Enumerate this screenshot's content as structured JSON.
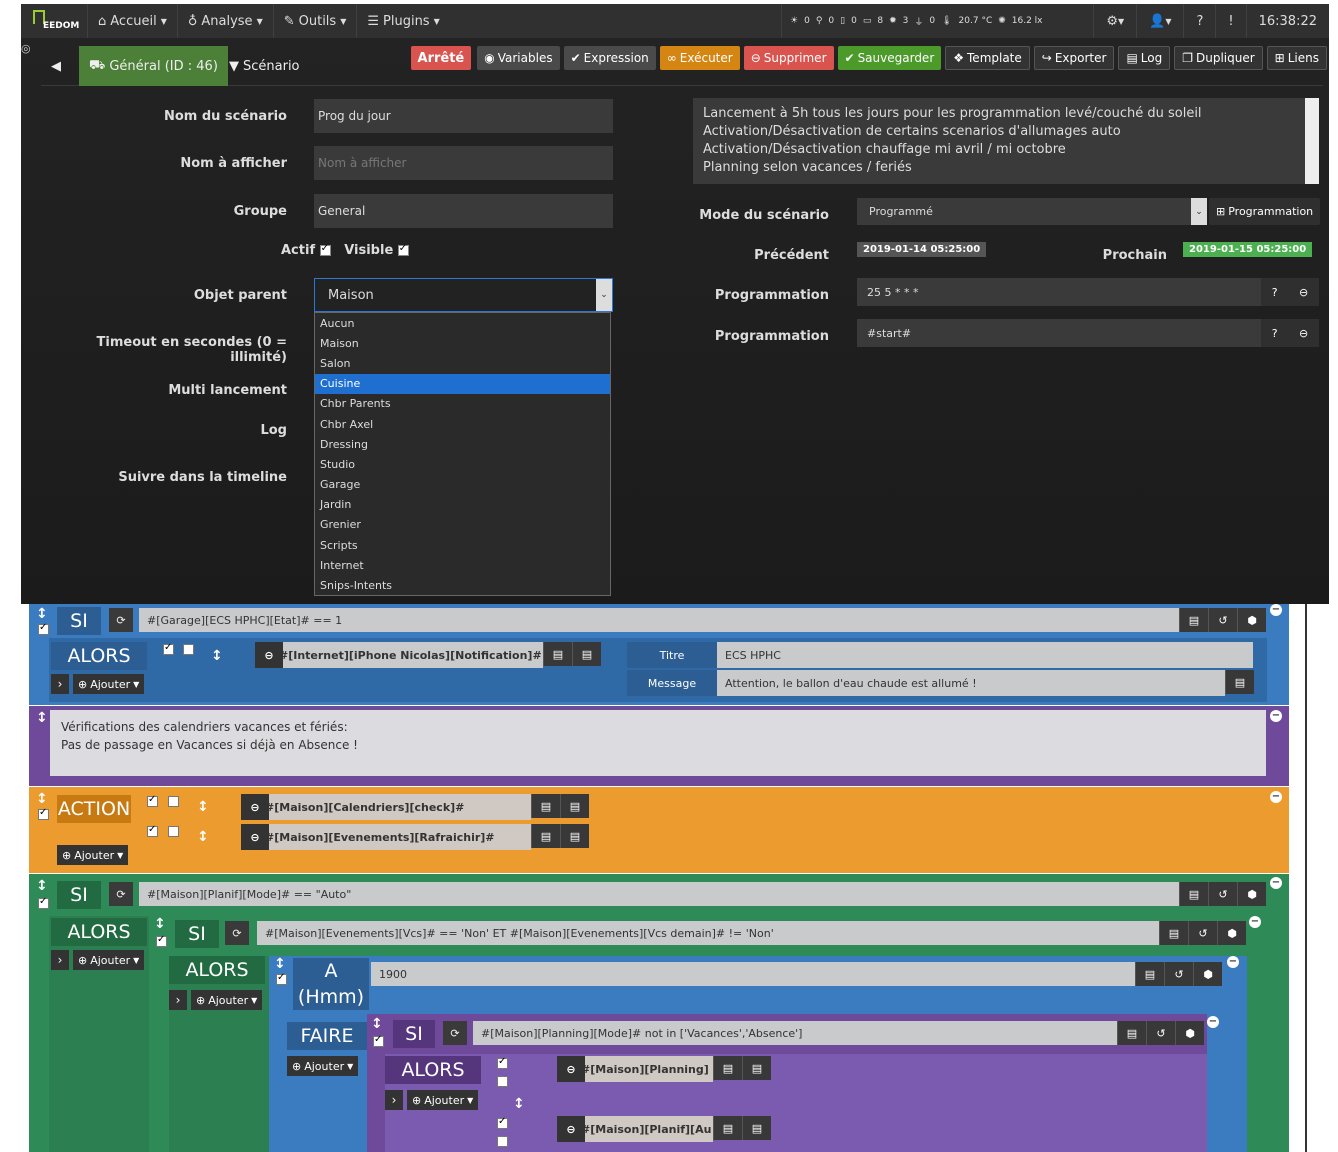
{
  "navbar": {
    "logo_text": "EEDOM",
    "items": [
      {
        "label": "Accueil",
        "icon": "home-icon"
      },
      {
        "label": "Analyse",
        "icon": "analyse-icon"
      },
      {
        "label": "Outils",
        "icon": "wrench-icon"
      },
      {
        "label": "Plugins",
        "icon": "list-icon"
      }
    ],
    "stats": [
      "0",
      "0",
      "0",
      "8",
      "3",
      "0",
      "20.7 °C",
      "16.2 lx"
    ],
    "time": "16:38:22"
  },
  "tabs": {
    "general": "Général (ID : 46)",
    "scenario": "Scénario"
  },
  "toolbar": {
    "status": "Arrêté",
    "buttons": [
      "Variables",
      "Expression",
      "Exécuter",
      "Supprimer",
      "Sauvegarder",
      "Template",
      "Exporter",
      "Log",
      "Dupliquer",
      "Liens"
    ]
  },
  "form": {
    "name_label": "Nom du scénario",
    "name_value": "Prog du jour",
    "display_label": "Nom à afficher",
    "display_placeholder": "Nom à afficher",
    "group_label": "Groupe",
    "group_value": "General",
    "actif_label": "Actif",
    "visible_label": "Visible",
    "parent_label": "Objet parent",
    "parent_value": "Maison",
    "timeout_label": "Timeout en secondes (0 = illimité)",
    "multi_label": "Multi lancement",
    "log_label": "Log",
    "timeline_label": "Suivre dans la timeline"
  },
  "dropdown": {
    "options": [
      "Aucun",
      "Maison",
      "Salon",
      "Cuisine",
      "Chbr Parents",
      "Chbr Axel",
      "Dressing",
      "Studio",
      "Garage",
      "Jardin",
      "Grenier",
      "Scripts",
      "Internet",
      "Snips-Intents"
    ],
    "highlighted": "Cuisine"
  },
  "description": [
    "Lancement à 5h tous les jours pour les programmation levé/couché du soleil",
    "Activation/Désactivation de certains scenarios d'allumages auto",
    "Activation/Désactivation chauffage mi avril / mi octobre",
    "Planning selon vacances / feriés"
  ],
  "mode": {
    "label": "Mode du scénario",
    "value": "Programmé",
    "prog_button": "Programmation",
    "prev_label": "Précédent",
    "prev_value": "2019-01-14 05:25:00",
    "next_label": "Prochain",
    "next_value": "2019-01-15 05:25:00",
    "prog_label": "Programmation",
    "prog1": "25 5 * * *",
    "prog2": "#start#"
  },
  "scenario": {
    "si1": {
      "kw": "SI",
      "cond": "#[Garage][ECS HPHC][Etat]# == 1"
    },
    "alors1": {
      "kw": "ALORS",
      "add": "Ajouter",
      "action": "#[Internet][iPhone Nicolas][Notification]#",
      "titre_label": "Titre",
      "titre_value": "ECS HPHC",
      "message_label": "Message",
      "message_value": "Attention, le ballon d'eau chaude est allumé !"
    },
    "comment": [
      "Vérifications des calendriers vacances et fériés:",
      "Pas de passage en Vacances si déjà en Absence !"
    ],
    "action": {
      "kw": "ACTION",
      "add": "Ajouter",
      "a1": "#[Maison][Calendriers][check]#",
      "a2": "#[Maison][Evenements][Rafraichir]#"
    },
    "si2": {
      "kw": "SI",
      "cond": "#[Maison][Planif][Mode]# == \"Auto\""
    },
    "alors2": {
      "kw": "ALORS",
      "add": "Ajouter"
    },
    "si3": {
      "kw": "SI",
      "cond": "#[Maison][Evenements][Vcs]# == 'Non' ET #[Maison][Evenements][Vcs demain]# != 'Non'"
    },
    "alors3": {
      "kw": "ALORS",
      "add": "Ajouter"
    },
    "a_block": {
      "kw1": "A",
      "kw2": "(Hmm)",
      "value": "1900"
    },
    "faire": {
      "kw": "FAIRE",
      "add": "Ajouter"
    },
    "si4": {
      "kw": "SI",
      "cond": "#[Maison][Planning][Mode]# not in ['Vacances','Absence']"
    },
    "alors4": {
      "kw": "ALORS",
      "add": "Ajouter",
      "a1": "#[Maison][Planning]",
      "a2": "#[Maison][Planif][Au"
    }
  },
  "colors": {
    "si_blue": "#3a7bbd",
    "alors_blue": "#306aa6",
    "comment_purple": "#6f4a9a",
    "action_orange": "#ec9c2e",
    "green": "#2e8b57",
    "purple2": "#7a5bb0"
  }
}
